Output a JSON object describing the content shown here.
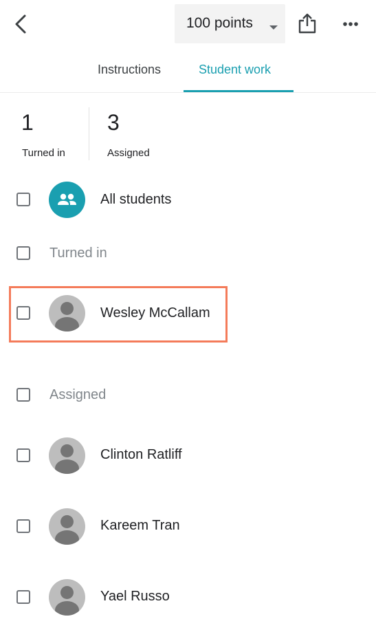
{
  "header": {
    "back_icon": "chevron-left-icon",
    "points_label": "100 points",
    "dropdown_icon": "caret-down-icon",
    "share_icon": "share-icon",
    "more_icon": "more-horizontal-icon"
  },
  "tabs": [
    {
      "label": "Instructions",
      "active": false
    },
    {
      "label": "Student work",
      "active": true
    }
  ],
  "stats": [
    {
      "value": "1",
      "label": "Turned in"
    },
    {
      "value": "3",
      "label": "Assigned"
    }
  ],
  "list": {
    "all_students": {
      "label": "All students",
      "icon": "people-icon"
    },
    "sections": [
      {
        "label": "Turned in",
        "students": [
          {
            "name": "Wesley McCallam",
            "highlighted": true
          }
        ]
      },
      {
        "label": "Assigned",
        "students": [
          {
            "name": "Clinton Ratliff"
          },
          {
            "name": "Kareem Tran"
          },
          {
            "name": "Yael Russo"
          }
        ]
      }
    ]
  },
  "colors": {
    "accent": "#1a9fb0",
    "highlight_border": "#f47b5a",
    "avatar_bg": "#bdbdbd"
  }
}
